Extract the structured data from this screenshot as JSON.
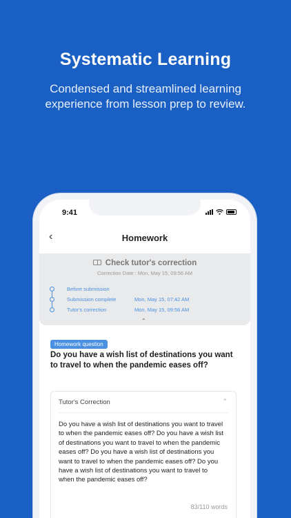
{
  "promo": {
    "title": "Systematic Learning",
    "subtitle": "Condensed and streamlined learning experience from lesson prep to review."
  },
  "status_bar": {
    "time": "9:41"
  },
  "nav": {
    "back_icon": "chevron-left-icon",
    "title": "Homework"
  },
  "correction_panel": {
    "title": "Check tutor's correction",
    "icon": "book-icon",
    "date": "Correction Date : Mon, May 15, 09:56 AM",
    "timeline": [
      {
        "label": "Before submission",
        "time": ""
      },
      {
        "label": "Submission complete",
        "time": "Mon, May 15, 07:42 AM"
      },
      {
        "label": "Tutor's correction",
        "time": "Mon, May 15, 09:56 AM"
      }
    ],
    "collapse_icon": "chevron-up-icon"
  },
  "homework": {
    "badge": "Homework question",
    "question": "Do you have a wish list of destinations you want to travel to when the pandemic eases off?"
  },
  "tutor_correction": {
    "header": "Tutor's Correction",
    "text": "Do you have a wish list of destinations you want to travel to when the pandemic eases off? Do you have a wish list of destinations you want to travel to when the pandemic eases off? Do you have a wish list of destinations you want to travel to when the pandemic eases off? Do you have a wish list of destinations you want to travel to when the pandemic eases off?",
    "word_count": "83",
    "word_limit": "/110 words"
  },
  "colors": {
    "background": "#1a5fc4",
    "accent": "#4a90e2"
  }
}
